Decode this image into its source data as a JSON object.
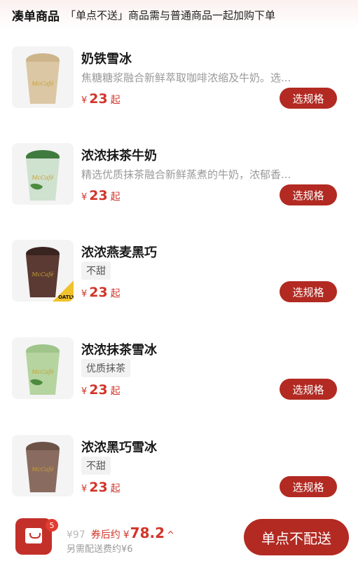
{
  "header": {
    "title": "凑单商品",
    "notice": "「单点不送」商品需与普通商品一起加购下单"
  },
  "products": [
    {
      "name": "奶铁雪冰",
      "desc": "焦糖糖浆融合新鲜萃取咖啡浓缩及牛奶。选...",
      "tag": "",
      "currency": "¥",
      "price": "23",
      "price_suffix": "起",
      "button": "选规格",
      "cup_top": "#cdb48a",
      "cup_body": "#dbc7a4",
      "brand_badge": ""
    },
    {
      "name": "浓浓抹茶牛奶",
      "desc": "精选优质抹茶融合新鲜蒸煮的牛奶，浓郁香...",
      "tag": "",
      "currency": "¥",
      "price": "23",
      "price_suffix": "起",
      "button": "选规格",
      "cup_top": "#3f7a3e",
      "cup_body": "#cfe1cf",
      "brand_badge": ""
    },
    {
      "name": "浓浓燕麦黑巧",
      "desc": "",
      "tag": "不甜",
      "currency": "¥",
      "price": "23",
      "price_suffix": "起",
      "button": "选规格",
      "cup_top": "#3a2420",
      "cup_body": "#5a3a33",
      "brand_badge": "OATLY"
    },
    {
      "name": "浓浓抹茶雪冰",
      "desc": "",
      "tag": "优质抹茶",
      "currency": "¥",
      "price": "23",
      "price_suffix": "起",
      "button": "选规格",
      "cup_top": "#9fc58a",
      "cup_body": "#b5d49f",
      "brand_badge": ""
    },
    {
      "name": "浓浓黑巧雪冰",
      "desc": "",
      "tag": "不甜",
      "currency": "¥",
      "price": "23",
      "price_suffix": "起",
      "button": "选规格",
      "cup_top": "#6d5248",
      "cup_body": "#8a6b60",
      "brand_badge": ""
    }
  ],
  "bottom_bar": {
    "cart_count": "5",
    "original_total": "¥97",
    "after_coupon_label": "券后约",
    "final_currency": "¥",
    "final_total": "78.2",
    "caret": "^",
    "delivery_note": "另需配送费约¥6",
    "action_button": "单点不配送"
  },
  "colors": {
    "accent": "#b22a22",
    "price_red": "#d2352a"
  }
}
